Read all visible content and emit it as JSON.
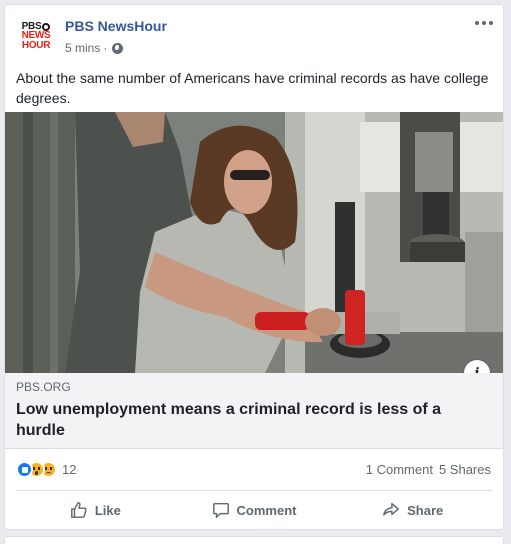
{
  "post": {
    "page_name": "PBS NewsHour",
    "avatar": {
      "line1": "PBS",
      "line2": "NEWS",
      "line3": "HOUR"
    },
    "time": "5 mins",
    "separator": "·",
    "text": "About the same number of Americans have criminal records as have college degrees."
  },
  "link": {
    "domain": "PBS.ORG",
    "title": "Low unemployment means a criminal record is less of a hurdle",
    "info_glyph": "i"
  },
  "engagement": {
    "reaction_icons": [
      "like-icon",
      "wow-icon",
      "sad-icon"
    ],
    "reaction_count": "12",
    "comments": "1 Comment",
    "shares": "5 Shares"
  },
  "actions": {
    "like": "Like",
    "comment": "Comment",
    "share": "Share"
  },
  "colors": {
    "brand_link": "#365899",
    "secondary_text": "#606770",
    "like_blue": "#1877f2",
    "pbs_red": "#e1251b"
  }
}
